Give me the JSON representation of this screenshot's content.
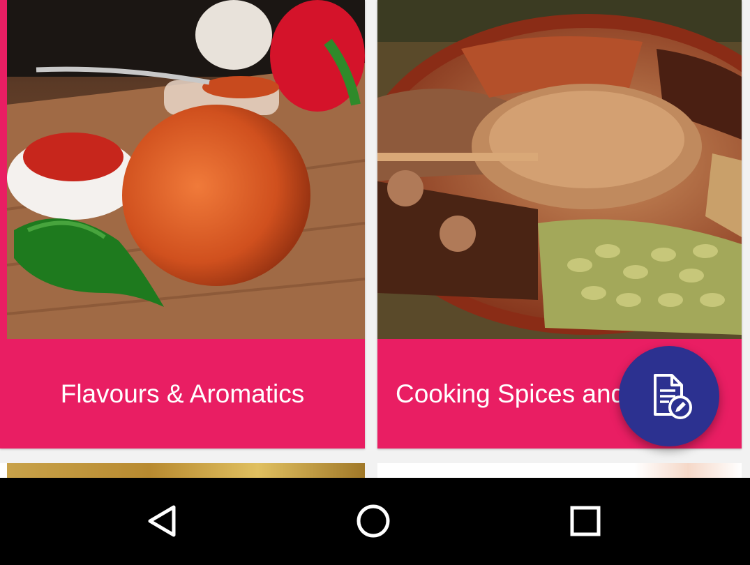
{
  "cards": [
    {
      "title": "Flavours & Aromatics",
      "image": "hot-sauce-jar-with-chili-pepper"
    },
    {
      "title": "Cooking Spices and Herbs",
      "image": "spice-platter"
    }
  ],
  "fab": {
    "icon": "edit-document-icon"
  },
  "navbar": {
    "back_icon": "back-triangle-icon",
    "home_icon": "home-circle-icon",
    "recent_icon": "recent-apps-square-icon"
  },
  "colors": {
    "caption_background": "#e91e63",
    "fab_background": "#2c3190",
    "navbar_background": "#000000"
  }
}
